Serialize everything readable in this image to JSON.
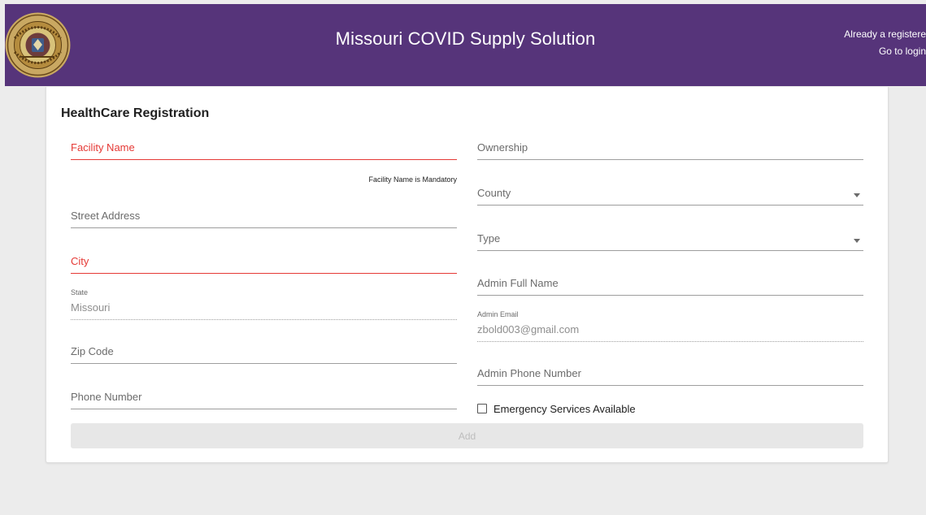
{
  "header": {
    "title": "Missouri COVID Supply Solution",
    "registered_prompt": "Already a registere",
    "login_link": "Go to login"
  },
  "form": {
    "title": "HealthCare Registration",
    "left": {
      "facility_name": {
        "label": "Facility Name",
        "error": "Facility Name is Mandatory"
      },
      "street_address": {
        "label": "Street Address"
      },
      "city": {
        "label": "City"
      },
      "state": {
        "label": "State",
        "value": "Missouri"
      },
      "zip_code": {
        "label": "Zip Code"
      },
      "phone_number": {
        "label": "Phone Number"
      }
    },
    "right": {
      "ownership": {
        "label": "Ownership"
      },
      "county": {
        "label": "County"
      },
      "type": {
        "label": "Type"
      },
      "admin_full_name": {
        "label": "Admin Full Name"
      },
      "admin_email": {
        "label": "Admin Email",
        "value": "zbold003@gmail.com"
      },
      "admin_phone": {
        "label": "Admin Phone Number"
      }
    },
    "emergency_checkbox": {
      "label": "Emergency Services Available",
      "checked": false
    },
    "add_button": "Add"
  },
  "colors": {
    "header_bg": "#56347a",
    "error": "#e53935",
    "page_bg": "#ececec"
  }
}
